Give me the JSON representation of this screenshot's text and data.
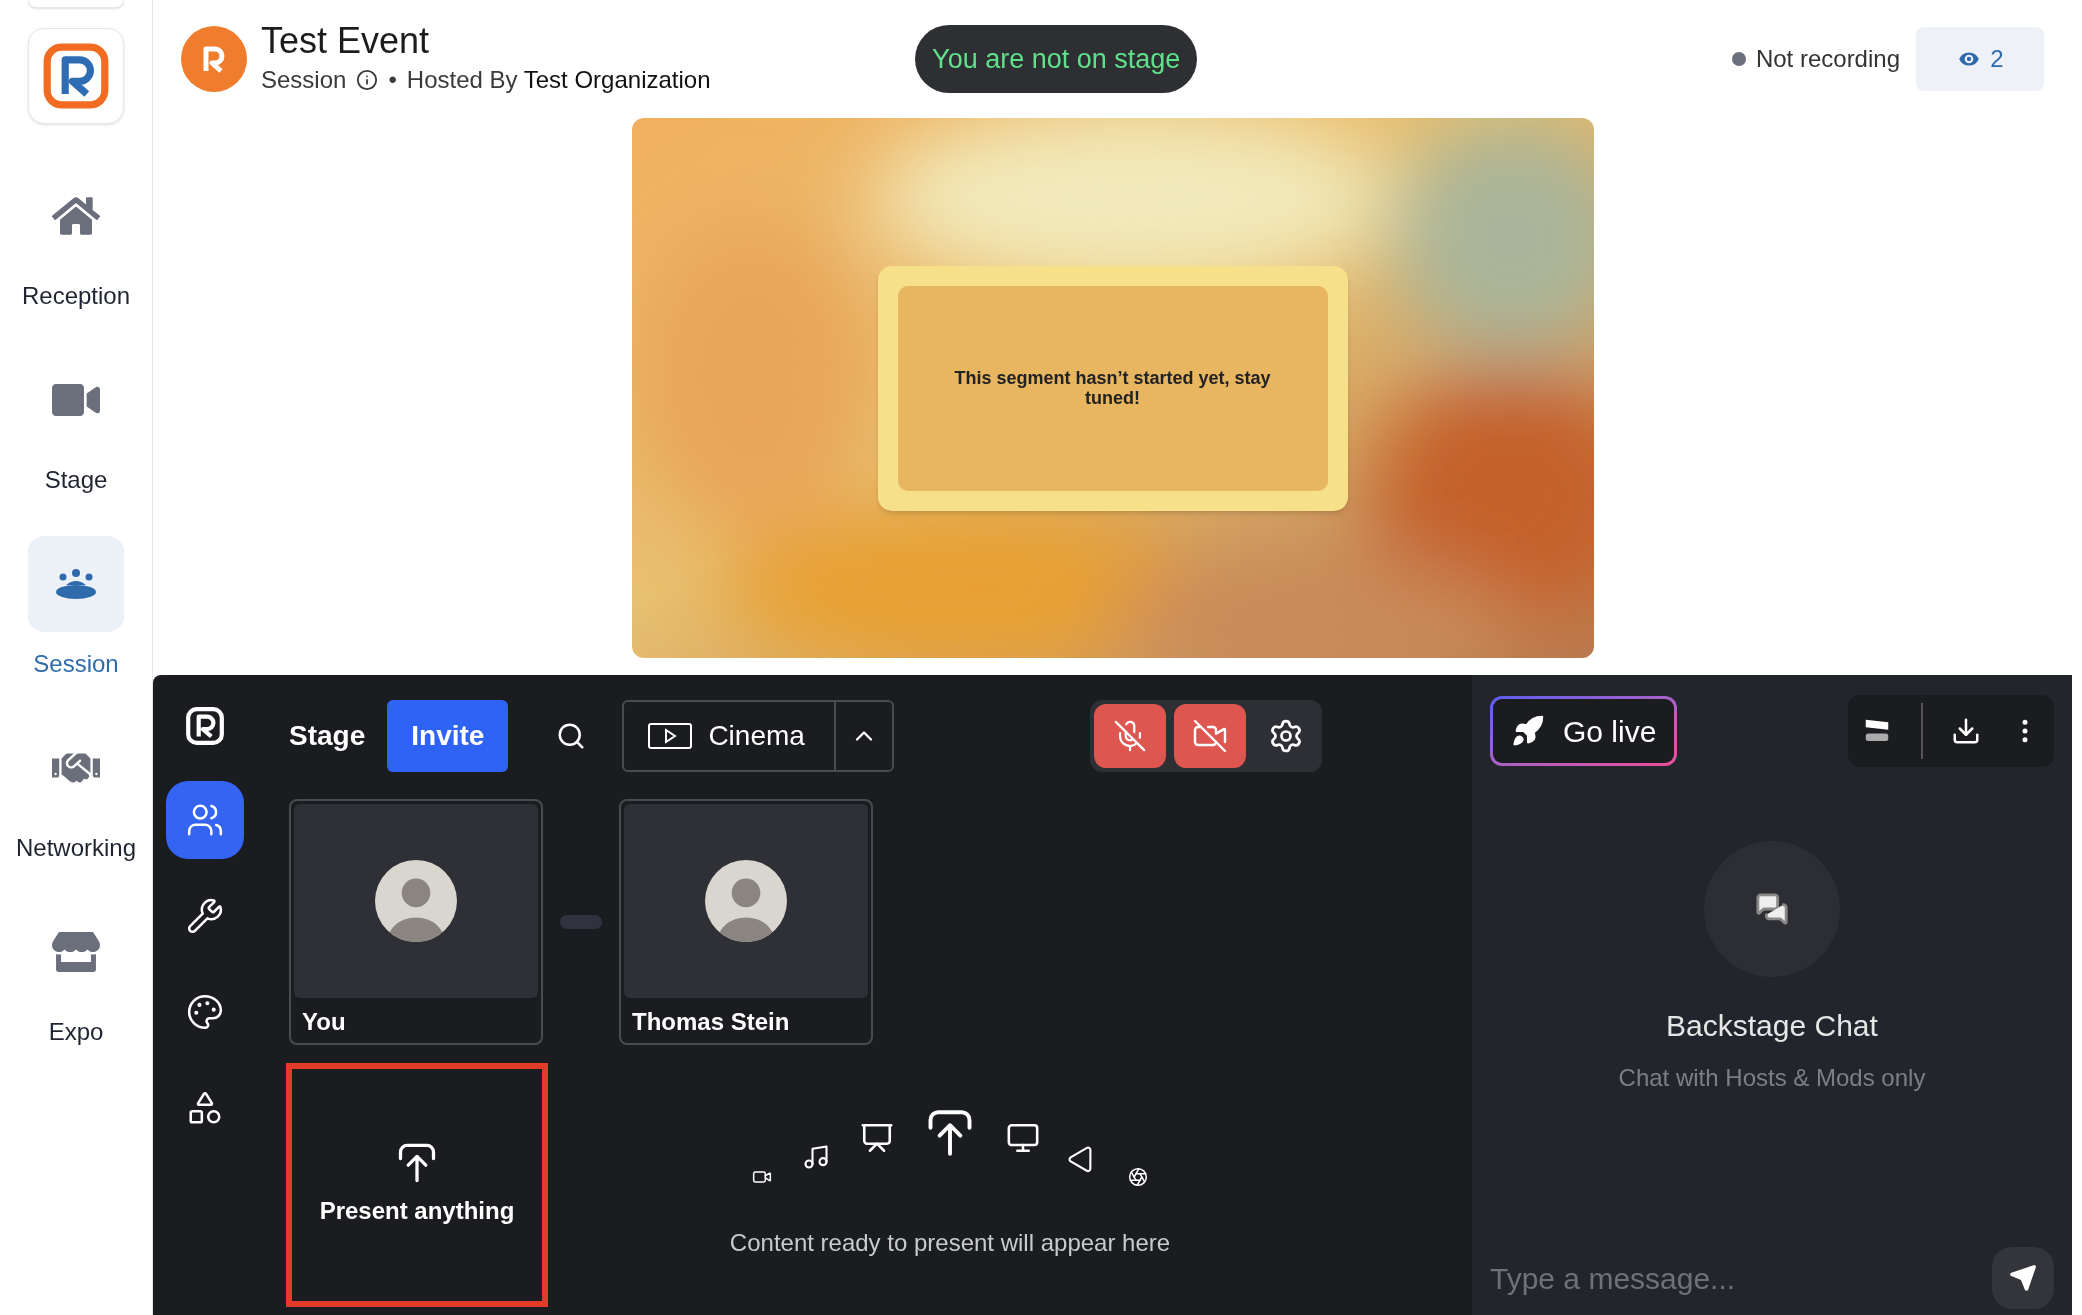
{
  "sidebar": {
    "items": [
      {
        "label": "Reception",
        "selected": false
      },
      {
        "label": "Stage",
        "selected": false
      },
      {
        "label": "Session",
        "selected": true
      },
      {
        "label": "Networking",
        "selected": false
      },
      {
        "label": "Expo",
        "selected": false
      }
    ]
  },
  "header": {
    "title": "Test Event",
    "session_label": "Session",
    "separator": "•",
    "hosted_by_prefix": "Hosted By",
    "organization": "Test Organization",
    "stage_status": "You are not on stage",
    "recording_status": "Not recording",
    "viewer_count": "2"
  },
  "stage_video": {
    "kind": "picture",
    "message": "This segment hasn’t started yet, stay tuned!"
  },
  "backstage": {
    "title": "Stage",
    "invite_button": "Invite",
    "layout_select": "Cinema",
    "mic_muted": true,
    "camera_off": true,
    "tools": [
      {
        "selected": true
      },
      {
        "selected": false
      },
      {
        "selected": false
      },
      {
        "selected": false
      }
    ],
    "participants": [
      {
        "name": "You"
      },
      {
        "name": "Thomas Stein"
      }
    ],
    "present_tile": {
      "label": "Present anything",
      "highlighted": true
    },
    "content_placeholder": "Content ready to present will appear here"
  },
  "chat": {
    "go_live": "Go live",
    "title": "Backstage Chat",
    "subtitle": "Chat with Hosts & Mods only",
    "input": {
      "placeholder": "Type a message..."
    }
  }
}
